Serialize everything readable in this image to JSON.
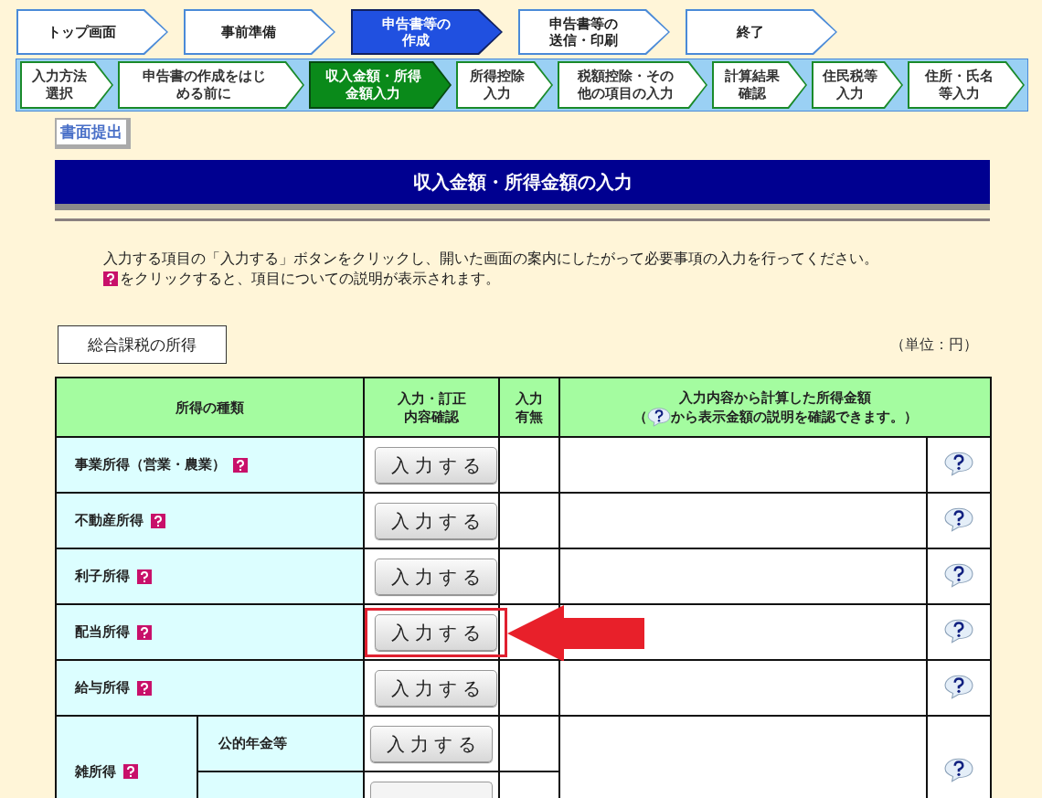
{
  "steps": [
    {
      "lines": [
        "トップ画面"
      ],
      "selected": false
    },
    {
      "lines": [
        "事前準備"
      ],
      "selected": false
    },
    {
      "lines": [
        "申告書等の",
        "作成"
      ],
      "selected": true
    },
    {
      "lines": [
        "申告書等の",
        "送信・印刷"
      ],
      "selected": false
    },
    {
      "lines": [
        "終了"
      ],
      "selected": false
    }
  ],
  "substeps": [
    {
      "lines": [
        "入力方法",
        "選択"
      ],
      "selected": false
    },
    {
      "lines": [
        "申告書の作成をはじ",
        "める前に"
      ],
      "selected": false
    },
    {
      "lines": [
        "収入金額・所得",
        "金額入力"
      ],
      "selected": true
    },
    {
      "lines": [
        "所得控除",
        "入力"
      ],
      "selected": false
    },
    {
      "lines": [
        "税額控除・その",
        "他の項目の入力"
      ],
      "selected": false
    },
    {
      "lines": [
        "計算結果",
        "確認"
      ],
      "selected": false
    },
    {
      "lines": [
        "住民税等",
        "入力"
      ],
      "selected": false
    },
    {
      "lines": [
        "住所・氏名",
        "等入力"
      ],
      "selected": false
    }
  ],
  "paper_button": "書面提出",
  "title": "収入金額・所得金額の入力",
  "intro": {
    "line1": "入力する項目の「入力する」ボタンをクリックし、開いた画面の案内にしたがって必要事項の入力を行ってください。",
    "line2": "をクリックすると、項目についての説明が表示されます。"
  },
  "section_label": "総合課税の所得",
  "unit": "（単位：円）",
  "table": {
    "columns": [
      {
        "lines": [
          "所得の種類"
        ]
      },
      {
        "lines": [
          "入力・訂正",
          "内容確認"
        ]
      },
      {
        "lines": [
          "入力",
          "有無"
        ]
      }
    ],
    "amount_header": {
      "title": "入力内容から計算した所得金額",
      "note_before": "（",
      "note_after": "から表示金額の説明を確認できます。）"
    },
    "rows": [
      {
        "label": "事業所得（営業・農業）",
        "button": "入力する",
        "highlighted": false
      },
      {
        "label": "不動産所得",
        "button": "入力する",
        "highlighted": false
      },
      {
        "label": "利子所得",
        "button": "入力する",
        "highlighted": false
      },
      {
        "label": "配当所得",
        "button": "入力する",
        "highlighted": true
      },
      {
        "label": "給与所得",
        "button": "入力する",
        "highlighted": false
      },
      {
        "label": "雑所得",
        "children": [
          {
            "kind": "item",
            "label": "公的年金等",
            "button": "入力する"
          },
          {
            "kind": "cut"
          }
        ]
      }
    ]
  }
}
